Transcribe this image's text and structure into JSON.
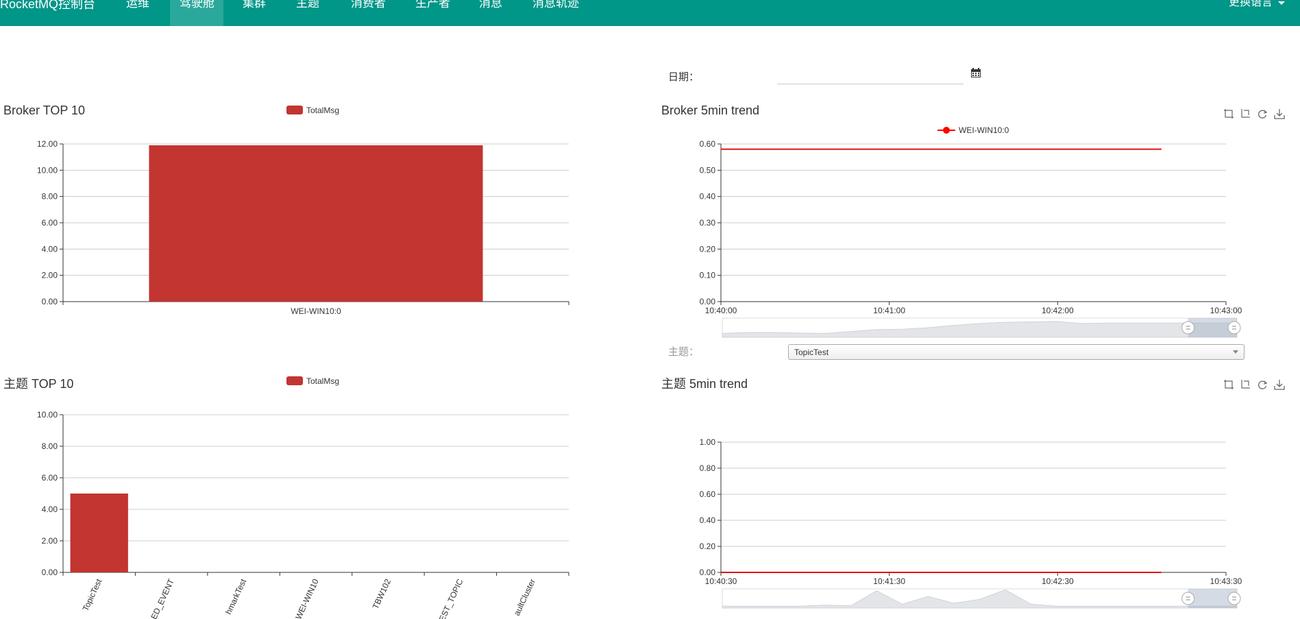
{
  "header": {
    "brand": "RocketMQ控制台",
    "nav": [
      {
        "label": "运维",
        "active": false
      },
      {
        "label": "驾驶舱",
        "active": true
      },
      {
        "label": "集群",
        "active": false
      },
      {
        "label": "主题",
        "active": false
      },
      {
        "label": "消费者",
        "active": false
      },
      {
        "label": "生产者",
        "active": false
      },
      {
        "label": "消息",
        "active": false
      },
      {
        "label": "消息轨迹",
        "active": false
      }
    ],
    "language_label": "更换语言"
  },
  "filters": {
    "date_label": "日期：",
    "date_value": "",
    "topic_label": "主题：",
    "topic_selected": "TopicTest"
  },
  "icons": {
    "calendar": "calendar-icon",
    "toolbox": [
      "zoom-icon",
      "zoom-reset-icon",
      "restore-icon",
      "save-image-icon"
    ],
    "caret": "chevron-down-icon"
  },
  "colors": {
    "header_bg": "#009688",
    "series": "#c23531",
    "axis": "#333333",
    "grid": "#cccccc"
  },
  "panels": {
    "broker_top": {
      "title": "Broker TOP 10",
      "legend": "TotalMsg"
    },
    "broker_trend": {
      "title": "Broker 5min trend",
      "legend": "WEI-WIN10:0"
    },
    "topic_top": {
      "title": "主题 TOP 10",
      "legend": "TotalMsg"
    },
    "topic_trend": {
      "title": "主题 5min trend"
    }
  },
  "chart_data": [
    {
      "id": "broker_top",
      "type": "bar",
      "categories": [
        "WEI-WIN10:0"
      ],
      "series": [
        {
          "name": "TotalMsg",
          "values": [
            11.9
          ]
        }
      ],
      "ylim": [
        0,
        12
      ],
      "y_ticks": [
        "0.00",
        "2.00",
        "4.00",
        "6.00",
        "8.00",
        "10.00",
        "12.00"
      ],
      "grid": true,
      "legend_position": "top-center"
    },
    {
      "id": "broker_trend",
      "type": "line",
      "x_ticks": [
        "10:40:00",
        "10:41:00",
        "10:42:00",
        "10:43:00"
      ],
      "x_range": [
        "10:40:00",
        "10:43:00"
      ],
      "series": [
        {
          "name": "WEI-WIN10:0",
          "x": [
            "10:40:00",
            "10:42:37"
          ],
          "values": [
            0.58,
            0.58
          ]
        }
      ],
      "ylim": [
        0,
        0.6
      ],
      "y_ticks": [
        "0.00",
        "0.10",
        "0.20",
        "0.30",
        "0.40",
        "0.50",
        "0.60"
      ],
      "grid": true,
      "legend_position": "top-center",
      "data_zoom": true
    },
    {
      "id": "topic_top",
      "type": "bar",
      "categories": [
        "TopicTest",
        "ED_EVENT",
        "hmarkTest",
        "WEI-WIN10",
        "TBW102",
        "EST_TOPIC",
        "aultCluster"
      ],
      "series": [
        {
          "name": "TotalMsg",
          "values": [
            5,
            0,
            0,
            0,
            0,
            0,
            0
          ]
        }
      ],
      "ylim": [
        0,
        10
      ],
      "y_ticks": [
        "0.00",
        "2.00",
        "4.00",
        "6.00",
        "8.00",
        "10.00"
      ],
      "grid": true,
      "legend_position": "top-center"
    },
    {
      "id": "topic_trend",
      "type": "line",
      "x_ticks": [
        "10:40:30",
        "10:41:30",
        "10:42:30",
        "10:43:30"
      ],
      "x_range": [
        "10:40:30",
        "10:43:30"
      ],
      "series": [
        {
          "x": [
            "10:40:30",
            "10:43:07"
          ],
          "values": [
            0,
            0
          ]
        }
      ],
      "ylim": [
        0,
        1
      ],
      "y_ticks": [
        "0.00",
        "0.20",
        "0.40",
        "0.60",
        "0.80",
        "1.00"
      ],
      "grid": true,
      "data_zoom": true
    }
  ]
}
